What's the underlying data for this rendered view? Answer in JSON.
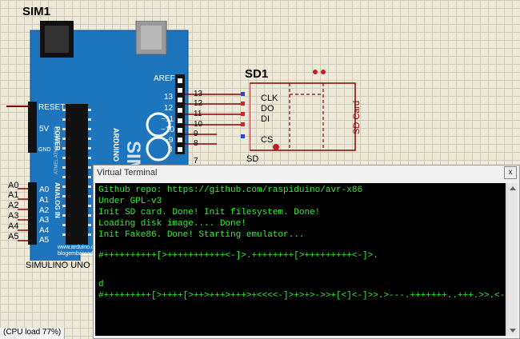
{
  "schematic": {
    "sim1_label": "SIM1",
    "board_label": "SIMULINO UNO",
    "aref": "AREF",
    "reset": "RESET",
    "v5": "5V",
    "gnd": "GND",
    "power": "POWER",
    "analog_in": "ANALOG IN",
    "arduino_text": "ARDUINO",
    "sim_brand": "SIM",
    "site1": "www.arduino.cc",
    "site2": "blogembarcado",
    "atmel": "ATMEL ATMEGA328P",
    "digital_pins": [
      "13",
      "12",
      "~11",
      "~10",
      "~9",
      "8"
    ],
    "analog_left_labels": [
      "A0",
      "A1",
      "A2",
      "A3",
      "A4",
      "A5"
    ],
    "analog_pin_labels": [
      "A0",
      "A1",
      "A2",
      "A3",
      "A4",
      "A5"
    ],
    "wire_numbers": [
      "13",
      "12",
      "11",
      "10",
      "9",
      "8"
    ],
    "seven": "7",
    "sd1_label": "SD1",
    "sd_pins": [
      "CLK",
      "DO",
      "DI",
      "CS"
    ],
    "sd_part": "SD",
    "sd_card": "SD Card"
  },
  "terminal": {
    "title": "Virtual Terminal",
    "close": "x",
    "lines": [
      "Github repo: https://github.com/raspiduino/avr-x86",
      "Under GPL-v3",
      "Init SD card. Done! Init filesystem. Done!",
      "Loading disk image.... Done!",
      "Init Fake86. Done! Starting emulator...",
      "",
      "#++++++++++[>+++++++++++<-]>.++++++++[>+++++++++<-]>.",
      "",
      "",
      "d",
      "#+++++++++[>++++[>++>+++>+++>+<<<<-]>+>+>->>+[<]<-]>>.>---.+++++++..+++.>>.<-.<.+++.------.--------.>>+.>++."
    ]
  },
  "status": {
    "cpu_load": "(CPU load 77%)"
  },
  "colors": {
    "board": "#1c75bd",
    "terminal_text": "#33ee33",
    "wire": "#a00000",
    "sd_outline": "#8b0000"
  }
}
